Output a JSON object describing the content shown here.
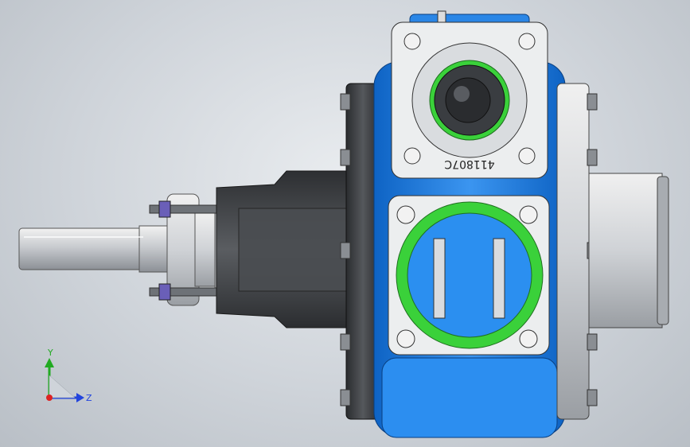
{
  "model": {
    "part_number": "411807C",
    "colors": {
      "background": "#d6dadf",
      "housing_blue": "#1f7fe0",
      "housing_blue_dark": "#0b5cb8",
      "steel": "#c9ccd0",
      "dark_cast": "#3b3d40",
      "seal_green": "#3ad13a",
      "bolt_purple": "#6a5fb8"
    }
  },
  "triad": {
    "y_label": "Y",
    "z_label": "Z",
    "colors": {
      "y": "#22aa22",
      "z": "#2244dd",
      "x": "#dd2222"
    }
  }
}
